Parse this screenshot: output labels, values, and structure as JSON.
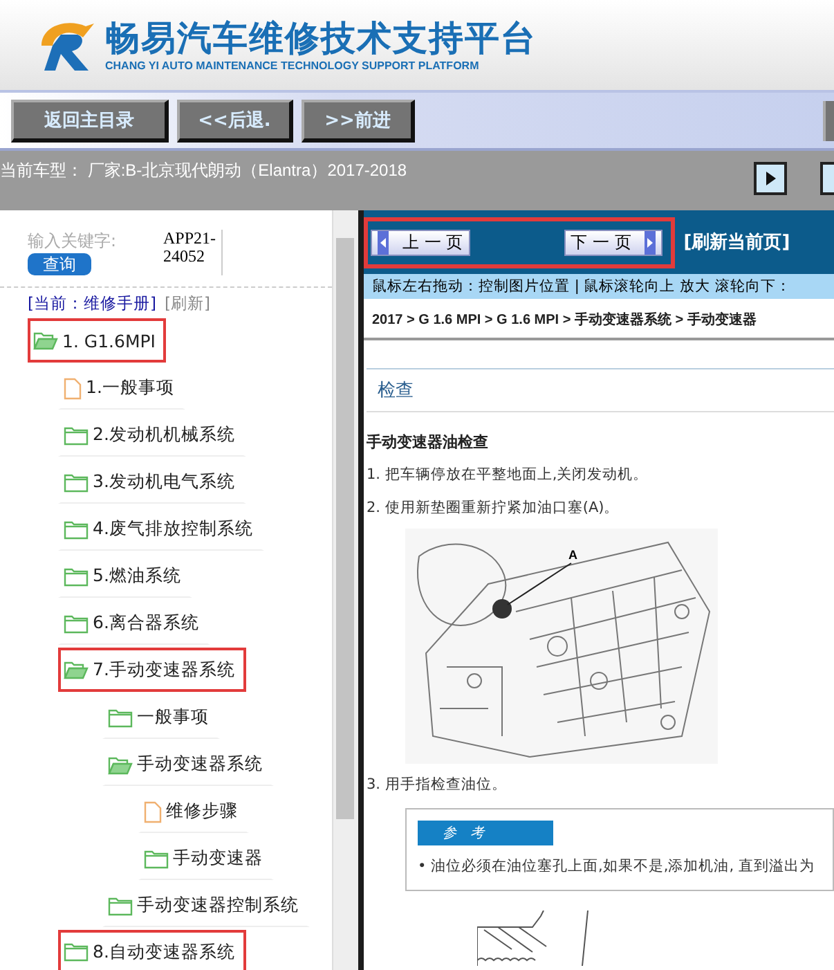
{
  "header": {
    "title": "畅易汽车维修技术支持平台",
    "subtitle": "CHANG YI AUTO MAINTENANCE TECHNOLOGY SUPPORT PLATFORM"
  },
  "toolbar": {
    "buttons": [
      "返回主目录",
      "<<后退.",
      ">>前进"
    ]
  },
  "vehicle_bar": {
    "text": "当前车型： 厂家:B-北京现代朗动（Elantra）2017-2018"
  },
  "search": {
    "label": "输入关键字:",
    "button": "查询",
    "value": "APP21-24052"
  },
  "manual_links": [
    {
      "label": "[当前：维修手册]",
      "selected": true
    },
    {
      "label": "[刷新]",
      "selected": false
    }
  ],
  "tree": [
    {
      "label": "1. G1.6MPI",
      "kind": "folder",
      "expanded": true,
      "highlighted": true,
      "children": [
        {
          "label": "1.一般事项",
          "kind": "file",
          "highlighted": false
        },
        {
          "label": "2.发动机机械系统",
          "kind": "folder",
          "expanded": false,
          "highlighted": false
        },
        {
          "label": "3.发动机电气系统",
          "kind": "folder",
          "expanded": false,
          "highlighted": false
        },
        {
          "label": "4.废气排放控制系统",
          "kind": "folder",
          "expanded": false,
          "highlighted": false
        },
        {
          "label": "5.燃油系统",
          "kind": "folder",
          "expanded": false,
          "highlighted": false
        },
        {
          "label": "6.离合器系统",
          "kind": "folder",
          "expanded": false,
          "highlighted": false
        },
        {
          "label": "7.手动变速器系统",
          "kind": "folder",
          "expanded": true,
          "highlighted": true,
          "children": [
            {
              "label": "一般事项",
              "kind": "folder",
              "expanded": false,
              "highlighted": false
            },
            {
              "label": "手动变速器系统",
              "kind": "folder",
              "expanded": true,
              "highlighted": false,
              "children": [
                {
                  "label": "维修步骤",
                  "kind": "file",
                  "highlighted": false
                },
                {
                  "label": "手动变速器",
                  "kind": "folder",
                  "expanded": false,
                  "highlighted": false
                }
              ]
            },
            {
              "label": "手动变速器控制系统",
              "kind": "folder",
              "expanded": false,
              "highlighted": false
            }
          ]
        },
        {
          "label": "8.自动变速器系统",
          "kind": "folder",
          "expanded": false,
          "highlighted": true
        }
      ]
    }
  ],
  "viewer": {
    "prev": "上 一 页",
    "next": "下 一 页",
    "nav_highlighted": true,
    "refresh": "[刷新当前页]",
    "hint": "鼠标左右拖动：控制图片位置 | 鼠标滚轮向上 放大  滚轮向下：",
    "breadcrumb": "2017 > G 1.6 MPI > G 1.6 MPI > 手动变速器系统 > 手动变速器",
    "section": "检查",
    "heading": "手动变速器油检查",
    "steps": [
      {
        "number": "1.",
        "text": "把车辆停放在平整地面上,关闭发动机。"
      },
      {
        "number": "2.",
        "text": "使用新垫圈重新拧紧加油口塞(A)。",
        "figure": {
          "callout": "A"
        }
      },
      {
        "number": "3.",
        "text": "用手指检查油位。"
      }
    ],
    "note": {
      "title": "参　考",
      "bullet": "• 油位必须在油位塞孔上面,如果不是,添加机油, 直到溢出为"
    }
  }
}
